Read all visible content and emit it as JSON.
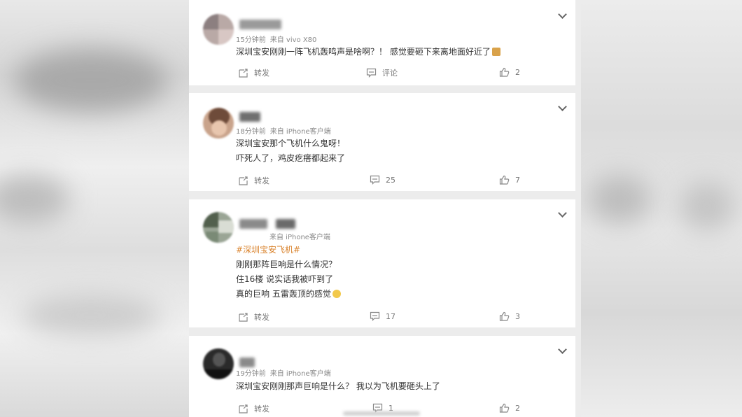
{
  "comments": [
    {
      "meta_time": "15分钟前",
      "meta_source": "来自 vivo X80",
      "lines": [
        "深圳宝安刚刚一阵飞机轰鸣声是啥啊？！ 感觉要砸下来离地面好近了"
      ],
      "repost_label": "转发",
      "comment_label": "评论",
      "likes": "2"
    },
    {
      "meta_time": "18分钟前",
      "meta_source": "来自 iPhone客户端",
      "lines": [
        "深圳宝安那个飞机什么鬼呀！",
        "吓死人了，鸡皮疙瘩都起来了"
      ],
      "repost_label": "转发",
      "comment_count": "25",
      "likes": "7"
    },
    {
      "meta_source": "来自 iPhone客户端",
      "hashtag": "#深圳宝安飞机#",
      "lines": [
        "刚刚那阵巨响是什么情况？",
        "住16楼 说实话我被吓到了",
        "真的巨响 五雷轰顶的感觉"
      ],
      "repost_label": "转发",
      "comment_count": "17",
      "likes": "3"
    },
    {
      "meta_time": "19分钟前",
      "meta_source": "来自 iPhone客户端",
      "lines": [
        "深圳宝安刚刚那声巨响是什么？ 我以为飞机要砸头上了"
      ],
      "repost_label": "转发",
      "comment_count": "1",
      "likes": "2"
    }
  ],
  "icons": {
    "expand": "chevron-down-icon",
    "repost": "repost-icon",
    "comment": "comment-icon",
    "like": "thumbs-up-icon"
  },
  "colors": {
    "hashtag": "#d9822b",
    "text": "#333333",
    "meta": "#8a8a8a",
    "background": "#ececec"
  }
}
